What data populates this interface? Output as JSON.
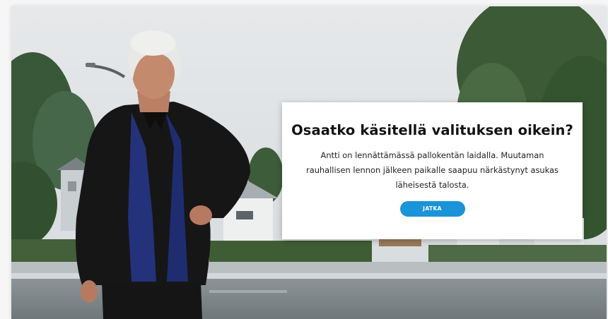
{
  "scene": {
    "background_description_colors": {
      "sky": "#dfe3e6",
      "trees": "#3e5f3e",
      "road": "#7e868a",
      "hedge": "#3f5d35"
    }
  },
  "dialog": {
    "title": "Osaatko käsitellä valituksen oikein?",
    "body": "Antti on lennättämässä pallokentän laidalla. Muutaman rauhallisen lennon jälkeen paikalle saapuu närkästynyt asukas läheisestä talosta.",
    "continue_label": "JATKA"
  },
  "colors": {
    "button": "#1a93d8",
    "title": "#121212"
  }
}
